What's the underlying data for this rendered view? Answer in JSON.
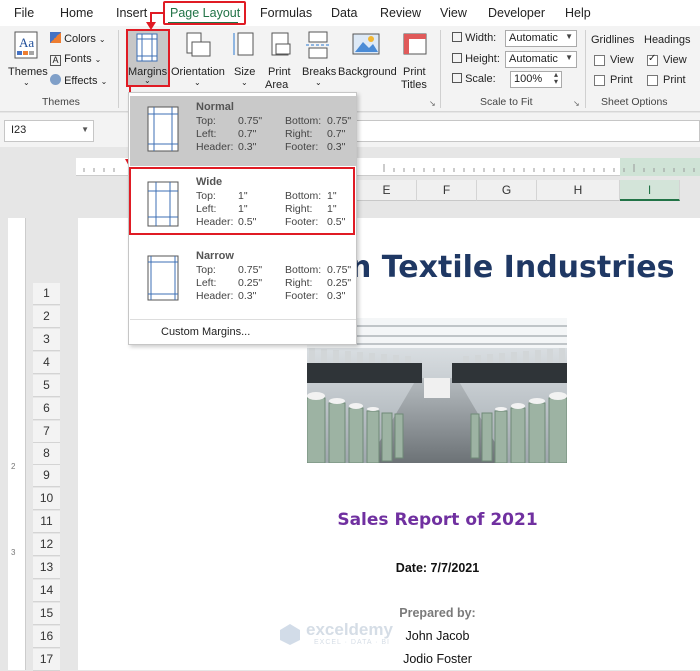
{
  "menubar": {
    "tabs": [
      "File",
      "Home",
      "Insert",
      "Page Layout",
      "Formulas",
      "Data",
      "Review",
      "View",
      "Developer",
      "Help"
    ],
    "active_tab": "Page Layout"
  },
  "ribbon": {
    "themes_group": {
      "themes_label": "Themes",
      "colors_label": "Colors",
      "fonts_label": "Fonts",
      "effects_label": "Effects",
      "group_label": "Themes"
    },
    "page_setup_group": {
      "margins_label": "Margins",
      "orientation_label": "Orientation",
      "size_label": "Size",
      "print_area_label_1": "Print",
      "print_area_label_2": "Area",
      "breaks_label": "Breaks",
      "background_label": "Background",
      "print_titles_label_1": "Print",
      "print_titles_label_2": "Titles"
    },
    "scale_group": {
      "width_label": "Width:",
      "width_value": "Automatic",
      "height_label": "Height:",
      "height_value": "Automatic",
      "scale_label": "Scale:",
      "scale_value": "100%",
      "group_label": "Scale to Fit"
    },
    "sheet_options_group": {
      "gridlines_label": "Gridlines",
      "headings_label": "Headings",
      "view_label": "View",
      "print_label": "Print",
      "gridlines_view": false,
      "gridlines_print": false,
      "headings_view": true,
      "headings_print": false,
      "group_label": "Sheet Options"
    }
  },
  "formula_bar": {
    "name_box": "I23",
    "formula": ""
  },
  "margins_menu": {
    "options": [
      {
        "name": "Normal",
        "top": "0.75\"",
        "bottom": "0.75\"",
        "left": "0.7\"",
        "right": "0.7\"",
        "header": "0.3\"",
        "footer": "0.3\""
      },
      {
        "name": "Wide",
        "top": "1\"",
        "bottom": "1\"",
        "left": "1\"",
        "right": "1\"",
        "header": "0.5\"",
        "footer": "0.5\""
      },
      {
        "name": "Narrow",
        "top": "0.75\"",
        "bottom": "0.75\"",
        "left": "0.25\"",
        "right": "0.25\"",
        "header": "0.3\"",
        "footer": "0.3\""
      }
    ],
    "labels": {
      "top": "Top:",
      "bottom": "Bottom:",
      "left": "Left:",
      "right": "Right:",
      "header": "Header:",
      "footer": "Footer:"
    },
    "custom_label": "Custom Margins...",
    "selected": "Normal",
    "highlighted": "Wide"
  },
  "sheet": {
    "column_headers": [
      "E",
      "F",
      "G",
      "H",
      "I"
    ],
    "selected_column": "I",
    "row_headers": [
      "1",
      "2",
      "3",
      "4",
      "5",
      "6",
      "7",
      "8",
      "9",
      "10",
      "11",
      "12",
      "13",
      "14",
      "15",
      "16",
      "17"
    ],
    "content": {
      "title_partial": "n Textile Industries",
      "sales_title": "Sales Report of 2021",
      "date": "Date: 7/7/2021",
      "prepared_by": "Prepared by:",
      "name_1": "John Jacob",
      "name_2": "Jodio Foster"
    },
    "watermark": {
      "name": "exceldemy",
      "tagline": "EXCEL · DATA · BI"
    }
  },
  "colors": {
    "accent": "#217346",
    "highlight_red": "#e01b24",
    "title_blue": "#1f3864",
    "sales_purple": "#7030a0"
  }
}
